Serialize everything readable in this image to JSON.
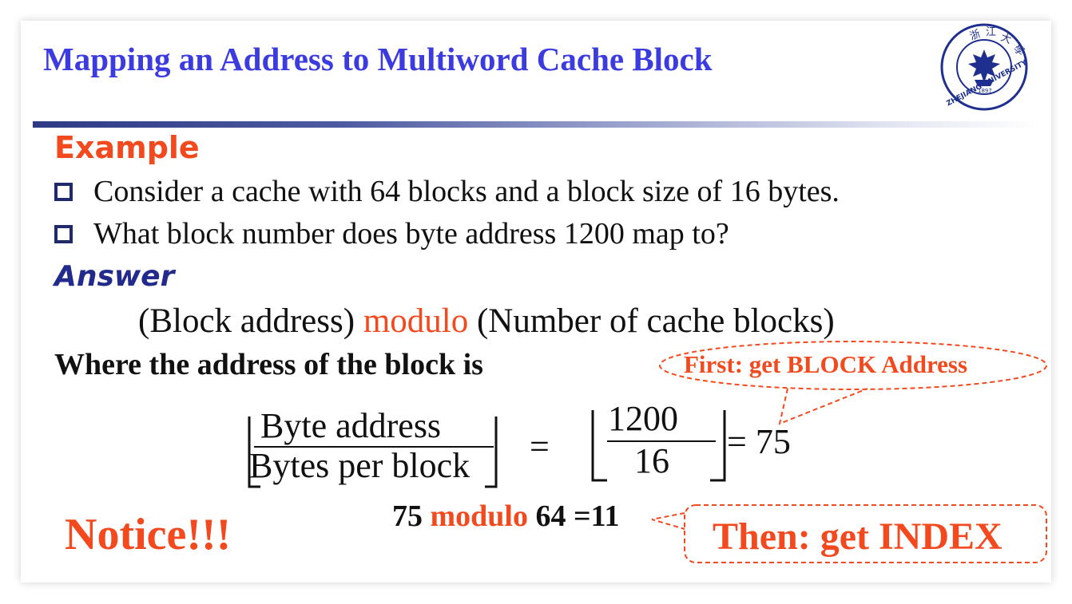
{
  "slide": {
    "title": "Mapping an Address to Multiword Cache Block",
    "logo": {
      "icon": "zhejiang-university-seal-icon",
      "text": "ZHEJIANG UNIVERSITY",
      "year": "1897",
      "color": "#1e2f8f"
    },
    "example_heading": "Example",
    "bullets": [
      "Consider a cache with 64 blocks and a block size of 16 bytes.",
      "What block number does byte address 1200 map to?"
    ],
    "answer_heading": "Answer",
    "formula": {
      "left": "(Block address)",
      "operator": "modulo",
      "right": "(Number of cache blocks)"
    },
    "where_text": "Where the address of the block is",
    "callout_first": "First: get BLOCK Address",
    "fraction": {
      "numerator": "Byte address",
      "denominator": "Bytes per block",
      "equals": "=",
      "num_value": "1200",
      "den_value": "16",
      "result": "= 75"
    },
    "notice": "Notice!!!",
    "mod_line": {
      "left": "75",
      "operator": "modulo",
      "right": "64 =11"
    },
    "callout_then": "Then: get INDEX",
    "colors": {
      "title": "#3b3be0",
      "accent_red": "#f24a1e",
      "answer_blue": "#222a8c",
      "bullet_box": "#1f2a6b"
    }
  }
}
